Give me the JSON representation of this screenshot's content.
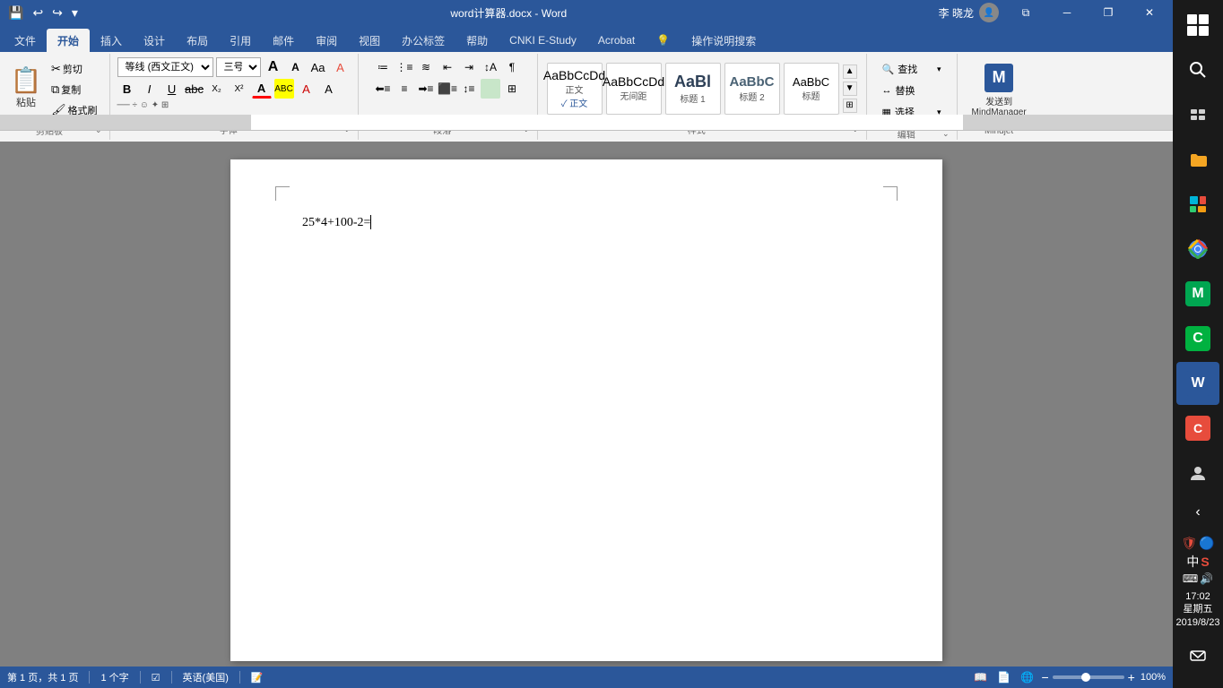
{
  "titlebar": {
    "title": "word计算器.docx - Word",
    "user": "李 晓龙",
    "minimize_label": "─",
    "restore_label": "❐",
    "close_label": "✕",
    "restore_down_label": "⧉"
  },
  "quickaccess": {
    "save_label": "💾",
    "undo_label": "↩",
    "redo_label": "↪",
    "dropdown_label": "▾"
  },
  "ribbon": {
    "tabs": [
      {
        "label": "文件",
        "active": false
      },
      {
        "label": "开始",
        "active": true
      },
      {
        "label": "插入",
        "active": false
      },
      {
        "label": "设计",
        "active": false
      },
      {
        "label": "布局",
        "active": false
      },
      {
        "label": "引用",
        "active": false
      },
      {
        "label": "邮件",
        "active": false
      },
      {
        "label": "审阅",
        "active": false
      },
      {
        "label": "视图",
        "active": false
      },
      {
        "label": "办公标签",
        "active": false
      },
      {
        "label": "帮助",
        "active": false
      },
      {
        "label": "CNKI E-Study",
        "active": false
      },
      {
        "label": "Acrobat",
        "active": false
      },
      {
        "label": "💡",
        "active": false
      },
      {
        "label": "操作说明搜索",
        "active": false
      }
    ],
    "groups": {
      "clipboard": {
        "label": "剪贴板",
        "paste_label": "粘贴",
        "cut_label": "剪切",
        "copy_label": "复制",
        "format_painter_label": "格式刷"
      },
      "font": {
        "label": "字体",
        "font_name": "等线 (西文正文)",
        "font_size": "三号",
        "grow_label": "A",
        "shrink_label": "A",
        "case_label": "Aa",
        "clear_label": "A",
        "color_label": "A",
        "highlight_label": "ABC",
        "bold_label": "B",
        "italic_label": "I",
        "underline_label": "U",
        "strikethrough_label": "abc",
        "subscript_label": "X₂",
        "superscript_label": "X²"
      },
      "paragraph": {
        "label": "段落",
        "bullets_label": "≡",
        "numbering_label": "≡",
        "multilevel_label": "≡",
        "decrease_indent_label": "⇤",
        "increase_indent_label": "⇥",
        "sort_label": "↕",
        "show_marks_label": "¶",
        "align_left_label": "≡",
        "align_center_label": "≡",
        "align_right_label": "≡",
        "justify_label": "≡",
        "line_spacing_label": "↕",
        "shading_label": "▒",
        "borders_label": "⊞"
      },
      "styles": {
        "label": "样式",
        "items": [
          {
            "sample": "AaBbCcDd",
            "name": "正文",
            "underline": false
          },
          {
            "sample": "AaBbCcDd",
            "name": "无间距",
            "underline": false
          },
          {
            "sample": "AaBl",
            "name": "标题 1",
            "underline": false
          },
          {
            "sample": "AaBbC",
            "name": "标题 2",
            "underline": false
          },
          {
            "sample": "AaBbC",
            "name": "标题",
            "underline": false
          }
        ]
      },
      "editing": {
        "label": "编辑",
        "find_label": "查找",
        "replace_label": "替换",
        "select_label": "选择"
      },
      "mindjet": {
        "label": "Mindjet",
        "send_label": "发送到\nMindManager"
      }
    }
  },
  "document": {
    "content": "25*4+100-2=",
    "cursor_visible": true
  },
  "statusbar": {
    "page_label": "第 1 页，共 1 页",
    "word_count_label": "1 个字",
    "track_label": "☑",
    "language_label": "英语(美国)",
    "layout_label": "▣",
    "zoom_percent": "100%",
    "view_modes": [
      "阅读",
      "页面",
      "Web"
    ]
  },
  "taskbar": {
    "time": "17:02",
    "day": "星期五",
    "date": "2019/8/23",
    "apps": [
      {
        "name": "windows-start",
        "label": "⊞"
      },
      {
        "name": "search",
        "label": "🔍"
      },
      {
        "name": "task-view",
        "label": "▣"
      },
      {
        "name": "file-explorer",
        "label": "📁"
      },
      {
        "name": "store",
        "label": "🛍"
      },
      {
        "name": "chrome",
        "label": "●"
      },
      {
        "name": "mindmanager-green",
        "label": "M"
      },
      {
        "name": "camtasia",
        "label": "C"
      },
      {
        "name": "word-active",
        "label": "W"
      },
      {
        "name": "camtasia2",
        "label": "C"
      }
    ],
    "system_tray": {
      "shield": "🛡",
      "volume": "🔊",
      "ime": "中",
      "input": "S"
    }
  }
}
